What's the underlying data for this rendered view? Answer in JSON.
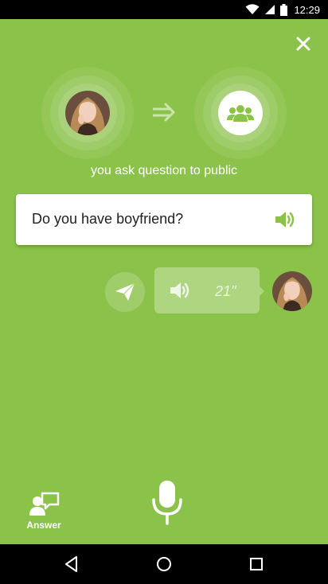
{
  "status_bar": {
    "time": "12:29",
    "icons": [
      "wifi-icon",
      "cell-signal-icon",
      "battery-icon"
    ]
  },
  "header": {
    "close_icon": "close-icon"
  },
  "flow": {
    "from_avatar": "user-avatar",
    "arrow_icon": "double-arrow-icon",
    "to_icon": "group-icon",
    "caption": "you ask question to public"
  },
  "question": {
    "text": "Do you have boyfriend?",
    "speaker_icon": "speaker-icon"
  },
  "voice_message": {
    "send_icon": "paper-plane-icon",
    "speaker_icon": "speaker-icon",
    "duration": "21\""
  },
  "bottom": {
    "answer_label": "Answer",
    "answer_icon": "answer-chat-icon",
    "mic_icon": "microphone-icon"
  },
  "nav": {
    "back_icon": "back-icon",
    "home_icon": "home-icon",
    "recents_icon": "recents-icon"
  },
  "colors": {
    "background": "#8bc34a",
    "accent": "#8bc34a",
    "card": "#ffffff"
  }
}
